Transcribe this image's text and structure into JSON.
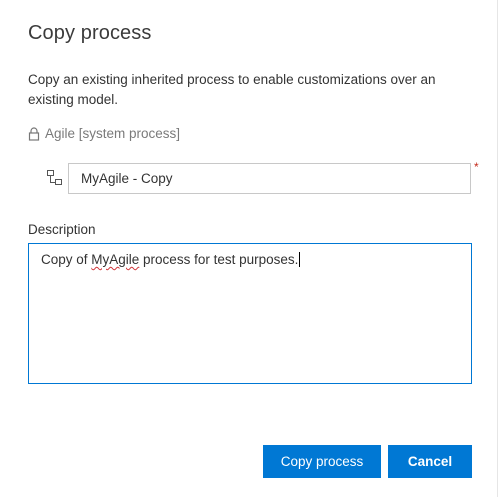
{
  "dialog": {
    "title": "Copy process",
    "description": "Copy an existing inherited process to enable customizations over an existing model.",
    "parent_process": "Agile [system process]",
    "name_value": "MyAgile - Copy",
    "required_mark": "*",
    "description_label": "Description",
    "description_value": {
      "before": "Copy of ",
      "misspelled": "MyAgile",
      "after": " process for test purposes."
    }
  },
  "buttons": {
    "copy_label": "Copy process",
    "cancel_label": "Cancel"
  },
  "colors": {
    "accent": "#0078d4",
    "required": "#c42b1c",
    "spellcheck": "#d13438"
  },
  "icons": {
    "lock": "lock-icon",
    "tree": "tree-hierarchy-icon"
  }
}
